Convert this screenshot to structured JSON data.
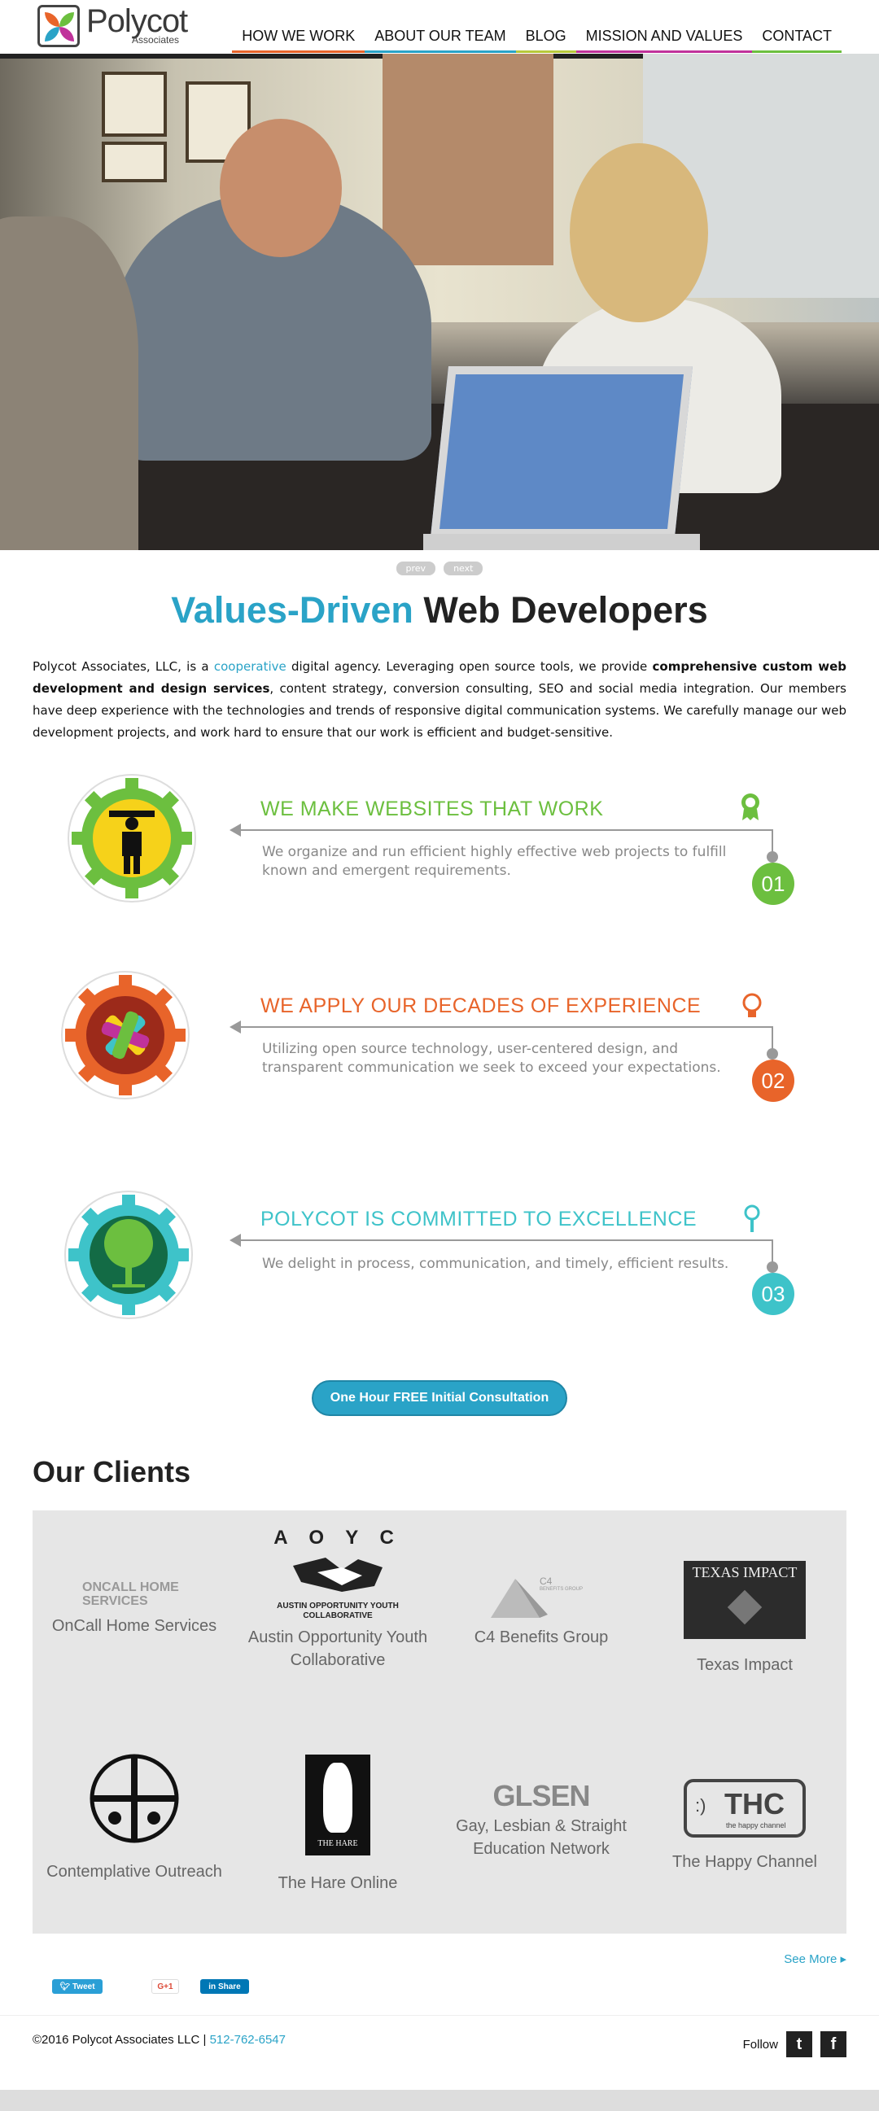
{
  "header": {
    "logo_name": "Polycot",
    "logo_sub": "Associates",
    "nav": [
      {
        "label": "HOW WE WORK",
        "color": "#e8642a"
      },
      {
        "label": "ABOUT OUR TEAM",
        "color": "#2aa3c7"
      },
      {
        "label": "BLOG",
        "color": "#b7c93a"
      },
      {
        "label": "MISSION AND VALUES",
        "color": "#c0329b"
      },
      {
        "label": "CONTACT",
        "color": "#6cbf3f"
      }
    ]
  },
  "slider": {
    "prev": "prev",
    "next": "next"
  },
  "headline": {
    "accent": "Values-Driven",
    "rest": " Web Developers"
  },
  "intro": {
    "p1": "Polycot Associates, LLC, is a ",
    "link": "cooperative",
    "p2": " digital agency. Leveraging open source tools, we provide ",
    "bold": "comprehensive custom web development and design services",
    "p3": ", content strategy, conversion consulting, SEO and social media integration. Our members have deep experience with the technologies and trends of responsive digital communication systems.  We carefully manage our web development projects, and work hard to ensure that our work is efficient and budget-sensitive."
  },
  "features": [
    {
      "title": "WE MAKE WEBSITES THAT WORK",
      "desc": "We organize and run efficient highly effective web projects to fulfill known and emergent requirements.",
      "num": "01",
      "color": "#6cbf3f",
      "icon": "ribbon-award-icon"
    },
    {
      "title": "WE APPLY OUR DECADES OF EXPERIENCE",
      "desc": "Utilizing  open source technology, user-centered design, and transparent communication we seek to exceed your expectations.",
      "num": "02",
      "color": "#e8642a",
      "icon": "lightbulb-icon"
    },
    {
      "title": "POLYCOT IS COMMITTED TO EXCELLENCE",
      "desc": "We delight in process, communication, and timely, efficient results.",
      "num": "03",
      "color": "#3ec3c9",
      "icon": "magnifier-icon"
    }
  ],
  "cta": "One Hour FREE Initial Consultation",
  "clients": {
    "title": "Our Clients",
    "items": [
      {
        "name": "OnCall Home Services",
        "logo_text": "ONCALL HOME SERVICES"
      },
      {
        "name": "Austin Opportunity Youth Collaborative",
        "logo_text": "A O Y C",
        "logo_sub": "AUSTIN OPPORTUNITY YOUTH COLLABORATIVE"
      },
      {
        "name": "C4 Benefits Group",
        "logo_text": "C4",
        "logo_sub": "BENEFITS GROUP"
      },
      {
        "name": "Texas Impact",
        "logo_text": "TEXAS IMPACT"
      },
      {
        "name": "Contemplative Outreach",
        "logo_text": ""
      },
      {
        "name": "The Hare Online",
        "logo_text": "THE HARE"
      },
      {
        "name": "Gay, Lesbian & Straight Education Network",
        "logo_text": "GLSEN"
      },
      {
        "name": "The Happy Channel",
        "logo_text": "THC",
        "logo_sub": "the happy channel"
      }
    ],
    "see_more": "See More ▸"
  },
  "share": {
    "tweet": "Tweet",
    "gplus": "G+1",
    "linkedin": "Share"
  },
  "footer": {
    "copyright": "©2016 Polycot Associates LLC | ",
    "phone": "512-762-6547",
    "follow": "Follow",
    "twitter_icon": "twitter-icon",
    "facebook_icon": "facebook-icon"
  }
}
